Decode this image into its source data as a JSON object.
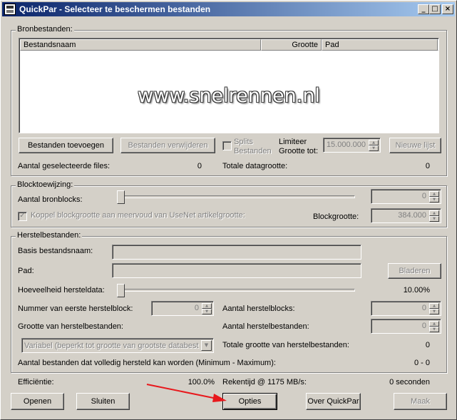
{
  "window": {
    "title": "QuickPar - Selecteer te beschermen bestanden",
    "minimize_glyph": "_",
    "maximize_glyph": "□",
    "close_glyph": "×"
  },
  "source_files": {
    "legend": "Bronbestanden:",
    "columns": [
      "Bestandsnaam",
      "Grootte",
      "Pad"
    ],
    "watermark": "www.snelrennen.nl",
    "add_button": "Bestanden toevoegen",
    "remove_button": "Bestanden verwijderen",
    "split_checkbox_label_line1": "Splits",
    "split_checkbox_label_line2": "Bestanden",
    "limit_label_line1": "Limiteer",
    "limit_label_line2": "Grootte tot:",
    "limit_value": "15.000.000",
    "new_list_button": "Nieuwe lijst",
    "selected_files_label": "Aantal geselecteerde files:",
    "selected_files_value": "0",
    "total_size_label": "Totale datagrootte:",
    "total_size_value": "0"
  },
  "block_allocation": {
    "legend": "Blocktoewijzing:",
    "source_blocks_label": "Aantal bronblocks:",
    "source_blocks_value": "0",
    "link_checkbox_label": "Koppel blockgrootte aan meervoud van UseNet artikelgrootte:",
    "block_size_label": "Blockgrootte:",
    "block_size_value": "384.000"
  },
  "recovery_files": {
    "legend": "Herstelbestanden:",
    "base_name_label": "Basis bestandsnaam:",
    "path_label": "Pad:",
    "browse_button": "Bladeren",
    "redundancy_label": "Hoeveelheid hersteldata:",
    "redundancy_value": "10.00%",
    "first_block_label": "Nummer van eerste herstelblock:",
    "first_block_value": "0",
    "recovery_blocks_label": "Aantal herstelblocks:",
    "recovery_blocks_value": "0",
    "file_sizing_label": "Grootte van herstelbestanden:",
    "recovery_files_count_label": "Aantal herstelbestanden:",
    "recovery_files_count_value": "0",
    "sizing_option": "Variabel (beperkt tot grootte van grootste databest",
    "total_recovery_size_label": "Totale grootte van herstelbestanden:",
    "total_recovery_size_value": "0",
    "fully_recoverable_label": "Aantal bestanden dat volledig hersteld kan worden (Minimum - Maximum):",
    "fully_recoverable_value": "0 - 0"
  },
  "footer": {
    "efficiency_label": "Efficiëntie:",
    "efficiency_value": "100.0%",
    "compute_time_label": "Rekentijd @ 1175 MB/s:",
    "compute_time_value": "0 seconden",
    "open_button": "Openen",
    "close_button": "Sluiten",
    "options_button": "Opties",
    "about_button": "Over QuickPar",
    "create_button": "Maak"
  },
  "colors": {
    "title_start": "#0a246a",
    "title_end": "#a6caf0",
    "face": "#d4d0c8",
    "annotation_arrow": "#e8181c"
  }
}
